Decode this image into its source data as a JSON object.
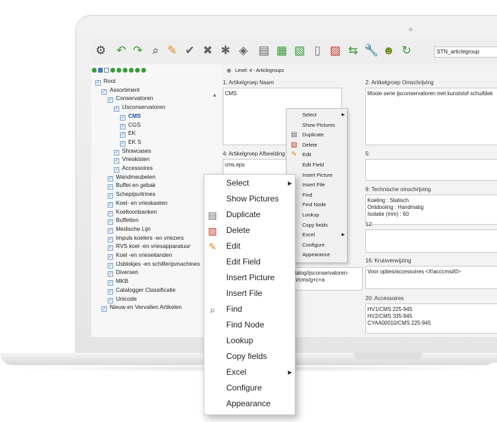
{
  "toolbar": {
    "icons": [
      "gear-icon",
      "undo-icon",
      "redo-icon",
      "search-icon",
      "edit-pencil-icon",
      "checkmark-icon",
      "close-x-icon",
      "asterisk-icon",
      "tag-icon",
      "document-icon",
      "add-document-icon",
      "export-document-icon",
      "page-icon",
      "delete-document-icon",
      "transfer-icon",
      "wrench-icon",
      "user-icon",
      "refresh-icon"
    ],
    "table_field": "STN_articlegroup"
  },
  "tree": {
    "items": [
      {
        "label": "Root",
        "level": 0
      },
      {
        "label": "Assortiment",
        "level": 1
      },
      {
        "label": "Conservatoren",
        "level": 2
      },
      {
        "label": "IJsconservatoren",
        "level": 3
      },
      {
        "label": "CMS",
        "level": 4,
        "selected": true
      },
      {
        "label": "CGS",
        "level": 4
      },
      {
        "label": "EK",
        "level": 4
      },
      {
        "label": "EK S",
        "level": 4
      },
      {
        "label": "Showcases",
        "level": 3
      },
      {
        "label": "Vrieskisten",
        "level": 3
      },
      {
        "label": "Accessoires",
        "level": 3
      },
      {
        "label": "Wandmeubelen",
        "level": 2
      },
      {
        "label": "Buffet en gebak",
        "level": 2
      },
      {
        "label": "Schepijsvitrines",
        "level": 2
      },
      {
        "label": "Koel- en vrieskasten",
        "level": 2
      },
      {
        "label": "Koeltoonbanken",
        "level": 2
      },
      {
        "label": "Buffetten",
        "level": 2
      },
      {
        "label": "Medische Lijn",
        "level": 2
      },
      {
        "label": "Impuls koelers -en vriezers",
        "level": 2
      },
      {
        "label": "RVS koel -en vriesapparatuur",
        "level": 2
      },
      {
        "label": "Koel -en vrieseilanden",
        "level": 2
      },
      {
        "label": "IJsblokjes -en schilferijsmachines",
        "level": 2
      },
      {
        "label": "Diversen",
        "level": 2
      },
      {
        "label": "MKB",
        "level": 2
      },
      {
        "label": "Catalogger Classificatie",
        "level": 2
      },
      {
        "label": "Unicode",
        "level": 2
      },
      {
        "label": "Nieuw en Vervallen Artikelen",
        "level": 1
      }
    ]
  },
  "form": {
    "level": "Level: 4 - Articlegroups",
    "fields": {
      "f1": {
        "label": "1: Artikelgroep Naam",
        "value": "CMS"
      },
      "f2": {
        "label": "2: Artikelgroep Omschrijving",
        "value": "Mooie serie ijsconservatoren met kunststof schuifdek"
      },
      "f4": {
        "label": "4: Artikelgroep Afbeelding",
        "value": "cms.eps"
      },
      "f5": {
        "label": "5:",
        "value": ""
      },
      "f9": {
        "label": "9: Technische omschrijving",
        "value": "Koeling : Statisch\nOntdooiing : Handmatig\nIsolatie (mm) : 60"
      },
      "f12": {
        "label": "12:",
        "value": ""
      },
      "f16": {
        "label": "16: Kruisverwijzing",
        "value": "Voor opties/accessoires <X\\acccms#0>"
      },
      "f_path": {
        "label": "",
        "value": "catalog/ijsconservatoren-\nren/cms/g+c+a"
      },
      "f20": {
        "label": "20: Accessoires",
        "value": "HV1/CMS 225-945\nHV2/CMS 335-945\nCYAA00010/CMS 225-945"
      }
    }
  },
  "menu_small": {
    "items": [
      {
        "label": "Select",
        "icon": "",
        "submenu": true
      },
      {
        "label": "Show Pictures",
        "icon": ""
      },
      {
        "label": "Duplicate",
        "icon": "duplicate-icon"
      },
      {
        "label": "Delete",
        "icon": "delete-icon"
      },
      {
        "label": "Edit",
        "icon": "edit-pencil-icon"
      },
      {
        "label": "Edit Field",
        "icon": ""
      },
      {
        "label": "Insert Picture",
        "icon": ""
      },
      {
        "label": "Insert File",
        "icon": ""
      },
      {
        "label": "Find",
        "icon": ""
      },
      {
        "label": "Find Node",
        "icon": ""
      },
      {
        "label": "Lookup",
        "icon": ""
      },
      {
        "label": "Copy fields",
        "icon": ""
      },
      {
        "label": "Excel",
        "icon": "",
        "submenu": true
      },
      {
        "label": "Configure",
        "icon": ""
      },
      {
        "label": "Appearance",
        "icon": ""
      }
    ]
  },
  "menu_big": {
    "items": [
      {
        "label": "Select",
        "icon": "",
        "submenu": true
      },
      {
        "label": "Show Pictures",
        "icon": ""
      },
      {
        "label": "Duplicate",
        "icon": "duplicate-icon"
      },
      {
        "label": "Delete",
        "icon": "delete-icon"
      },
      {
        "label": "Edit",
        "icon": "edit-pencil-icon"
      },
      {
        "label": "Edit Field",
        "icon": ""
      },
      {
        "label": "Insert Picture",
        "icon": ""
      },
      {
        "label": "Insert File",
        "icon": ""
      },
      {
        "label": "Find",
        "icon": "search-icon"
      },
      {
        "label": "Find Node",
        "icon": ""
      },
      {
        "label": "Lookup",
        "icon": ""
      },
      {
        "label": "Copy fields",
        "icon": ""
      },
      {
        "label": "Excel",
        "icon": "",
        "submenu": true
      },
      {
        "label": "Configure",
        "icon": ""
      },
      {
        "label": "Appearance",
        "icon": ""
      }
    ]
  },
  "colors": {
    "accent": "#1e4f9c",
    "toolbar_green": "#3a9a3a",
    "delete_red": "#c0392b",
    "edit_orange": "#e08a1e"
  }
}
